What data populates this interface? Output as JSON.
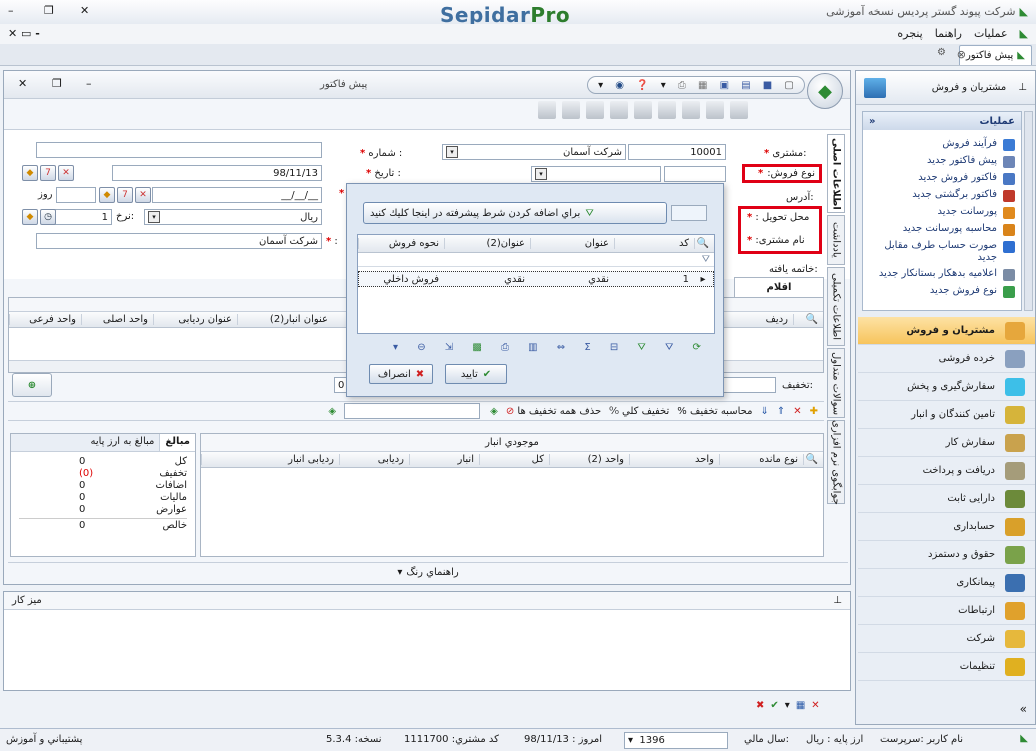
{
  "app": {
    "window_title": "شرکت پیوند گستر پردیس نسخه آموزشی",
    "brand": "SepidarPro",
    "menu": [
      "عملیات",
      "راهنما",
      "پنجره"
    ],
    "open_tab": "پیش فاکتور"
  },
  "invoice": {
    "title": "پیش فاکتور",
    "labels": {
      "customer": "مشتری:",
      "sale_type": "نوع فروش:",
      "address": "آدرس:",
      "delivery": "محل تحویل :",
      "customer_name": "نام مشتری:",
      "ending": "خاتمه يافته:",
      "number": "شماره :",
      "date": "تاریخ :",
      "rate": "نرخ:",
      "day": "روز",
      "discount": "تخفیف:"
    },
    "values": {
      "customer_code": "10001",
      "customer_name": "شرکت آسمان",
      "date": "98/11/13",
      "date_empty": "__/__/__",
      "currency": "ريال",
      "rate": "1",
      "party": "شرکت آسمان",
      "discount": "0"
    },
    "side_tabs": [
      "اطلاعات اصلی",
      "یادداشت",
      "اطلاعات تکمیلی",
      "سوالات متداول",
      "جوابگوی نرم افزاری"
    ],
    "items_tab": "اقلام",
    "items_columns": [
      "ردیف",
      "عنوان انبار(2)",
      "عنوان ردیابی",
      "واحد اصلی",
      "واحد فرعی"
    ],
    "actions": {
      "calc_discount": "محاسبه تخفيف",
      "total_discount": "تخفيف کلي",
      "remove_all": "حذف همه تخفيف ها"
    }
  },
  "summary": {
    "tabs": [
      "مبالغ",
      "مبالغ به ارز پایه"
    ],
    "rows": [
      {
        "label": "کل",
        "value": "0"
      },
      {
        "label": "تخفیف",
        "value": "(0)"
      },
      {
        "label": "اضافات",
        "value": "0"
      },
      {
        "label": "مالیات",
        "value": "0"
      },
      {
        "label": "عوارض",
        "value": "0"
      },
      {
        "label": "خالص",
        "value": "0"
      }
    ]
  },
  "inventory": {
    "title": "موجودي انبار",
    "columns": [
      "نوع مانده",
      "واحد",
      "واحد (2)",
      "کل",
      "انبار",
      "ردیابی",
      "ردیابی انبار"
    ]
  },
  "color_guide": "راهنماي رنگ",
  "desk": {
    "title": "میز کار"
  },
  "dialog": {
    "filter_hint": "براي اضافه کردن شرط پيشرفته در اينجا کليك کنيد",
    "columns": [
      "کد",
      "عنوان",
      "عنوان(2)",
      "نحوه فروش"
    ],
    "rows": [
      {
        "code": "1",
        "title": "نقدي",
        "title2": "نقدي",
        "sale_mode": "فروش داخلي"
      }
    ],
    "ok": "تاييد",
    "cancel": "انصراف"
  },
  "sidebar": {
    "title": "مشتریان و فروش",
    "ops_header": "عملیات",
    "ops": [
      {
        "label": "فرآیند فروش",
        "color": "#3b7bd5"
      },
      {
        "label": "پیش فاکتور جدید",
        "color": "#6d86b7"
      },
      {
        "label": "فاکتور فروش جدید",
        "color": "#4a78c4"
      },
      {
        "label": "فاکتور برگشتی جدید",
        "color": "#c0392b"
      },
      {
        "label": "پورسانت جدید",
        "color": "#e08a1e"
      },
      {
        "label": "محاسبه پورسانت جدید",
        "color": "#d9841a"
      },
      {
        "label": "صورت حساب طرف مقابل جدید",
        "color": "#2f6fd1"
      },
      {
        "label": "اعلامیه بدهکار بستانکار جدید",
        "color": "#7b8ca5"
      },
      {
        "label": "نوع فروش جدید",
        "color": "#3a9e4b"
      }
    ],
    "nav": [
      {
        "label": "مشتریان و فروش",
        "color": "#e6a73c",
        "active": true
      },
      {
        "label": "خرده فروشی",
        "color": "#8aa0bf"
      },
      {
        "label": "سفارش‌گیری و پخش",
        "color": "#3dbfe8"
      },
      {
        "label": "تامین کنندگان و انبار",
        "color": "#d6b43a"
      },
      {
        "label": "سفارش کار",
        "color": "#c9a24d"
      },
      {
        "label": "دریافت و پرداخت",
        "color": "#a59c7a"
      },
      {
        "label": "دارایی ثابت",
        "color": "#6c8a3a"
      },
      {
        "label": "حسابداری",
        "color": "#d9a02a"
      },
      {
        "label": "حقوق و دستمزد",
        "color": "#7aa24a"
      },
      {
        "label": "پیمانکاری",
        "color": "#3b6fb0"
      },
      {
        "label": "ارتباطات",
        "color": "#e0a12c"
      },
      {
        "label": "شرکت",
        "color": "#e6b83c"
      },
      {
        "label": "تنظیمات",
        "color": "#e0b020"
      }
    ]
  },
  "status": {
    "support": "پشتيباني و آموزش",
    "version_label": "نسخه:",
    "version": "5.3.4",
    "customer_code_label": "کد مشتري:",
    "customer_code": "1111700",
    "today_label": "امروز :",
    "today": "98/11/13",
    "year_label": "سال مالي:",
    "year": "1396",
    "currency_label": "ارز پايه :",
    "currency": "ريال",
    "user": "نام کاربر :سرپرست"
  }
}
